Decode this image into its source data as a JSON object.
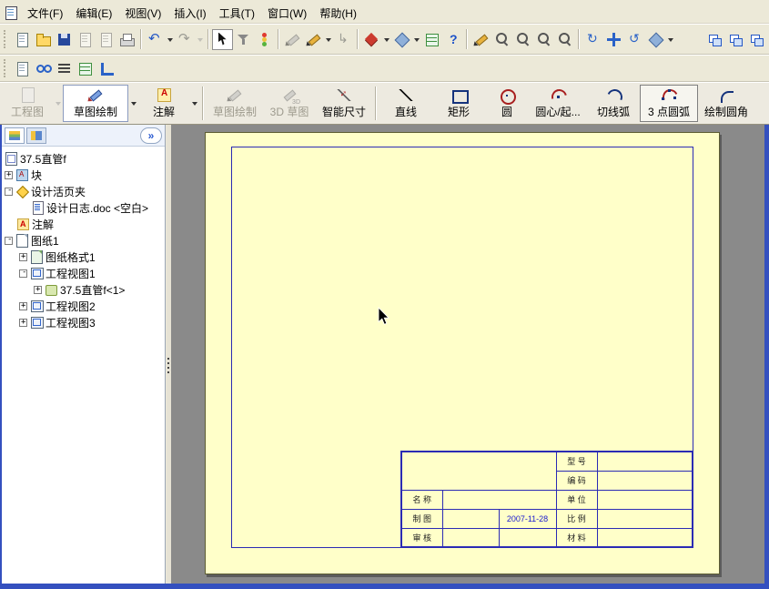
{
  "menubar": {
    "items": [
      "文件(F)",
      "编辑(E)",
      "视图(V)",
      "插入(I)",
      "工具(T)",
      "窗口(W)",
      "帮助(H)"
    ]
  },
  "command_manager": {
    "tabs": [
      {
        "label": "工程图",
        "disabled": true
      },
      {
        "label": "草图绘制",
        "active": true
      },
      {
        "label": "注解"
      }
    ],
    "tools": [
      {
        "label": "草图绘制",
        "disabled": true
      },
      {
        "label": "3D 草图",
        "disabled": true
      },
      {
        "label": "智能尺寸"
      },
      {
        "label": "直线"
      },
      {
        "label": "矩形"
      },
      {
        "label": "圆"
      },
      {
        "label": "圆心/起..."
      },
      {
        "label": "切线弧"
      },
      {
        "label": "3 点圆弧",
        "selected": true
      },
      {
        "label": "绘制圆角"
      }
    ]
  },
  "feature_tree": {
    "chevron": "»",
    "items": [
      {
        "label": "37.5直管f"
      },
      {
        "label": "块"
      },
      {
        "label": "设计活页夹"
      },
      {
        "label": "设计日志.doc <空白>"
      },
      {
        "label": "注解"
      },
      {
        "label": "图纸1"
      },
      {
        "label": "图纸格式1"
      },
      {
        "label": "工程视图1"
      },
      {
        "label": "37.5直管f<1>"
      },
      {
        "label": "工程视图2"
      },
      {
        "label": "工程视图3"
      }
    ]
  },
  "title_block": {
    "labels": {
      "model": "型 号",
      "code": "编 码",
      "name": "名 称",
      "unit": "单 位",
      "draft": "制 图",
      "scale": "比 例",
      "check": "审 核",
      "material": "材 料"
    },
    "date": "2007-11-28"
  },
  "toolbar_icons": [
    "new-document",
    "open",
    "save",
    "make-drawing-from-part",
    "make-assembly-from-part",
    "print",
    "undo",
    "redo",
    "select",
    "selection-filter",
    "display-states",
    "edit-sketch",
    "sketch",
    "exit-sketch",
    "standard-views",
    "view-orientation",
    "tables",
    "help",
    "annotate-pen",
    "zoom-to-fit",
    "zoom-to-area",
    "zoom-in-out",
    "zoom-to-selection",
    "rebuild",
    "pan",
    "rotate-view",
    "display-style",
    "new-window",
    "cascade-windows",
    "tile-windows"
  ],
  "drawing_toolbar_icons": [
    "sheet-properties",
    "view-palette",
    "line-format",
    "tables",
    "datum"
  ]
}
